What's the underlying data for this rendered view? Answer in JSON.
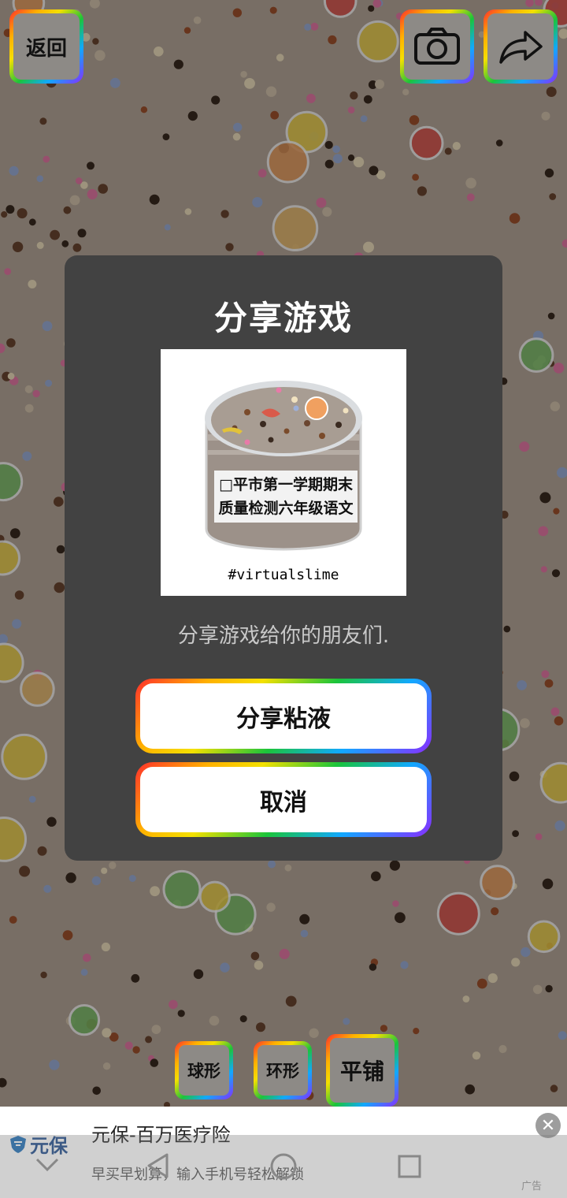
{
  "header": {
    "back_label": "返回",
    "camera_icon": "camera-icon",
    "share_icon": "share-arrow-icon"
  },
  "dialog": {
    "title": "分享游戏",
    "preview": {
      "jar_label_line1": "□平市第一学期期末",
      "jar_label_line2": "质量检测六年级语文",
      "hashtag": "#virtualslime"
    },
    "description": "分享游戏给你的朋友们.",
    "share_button": "分享粘液",
    "cancel_button": "取消"
  },
  "toolbar": {
    "sphere_label": "球形",
    "ring_label": "环形",
    "flat_label": "平铺"
  },
  "ad": {
    "brand": "元保",
    "title": "元保-百万医疗险",
    "subtitle": "早买早划算，输入手机号轻松解锁",
    "marker": "广告"
  },
  "colors": {
    "dialog_bg": "#424242",
    "slime_bg": "#b9aa9b",
    "button_bg": "#ffffff",
    "brand_blue": "#1d4a8c"
  }
}
